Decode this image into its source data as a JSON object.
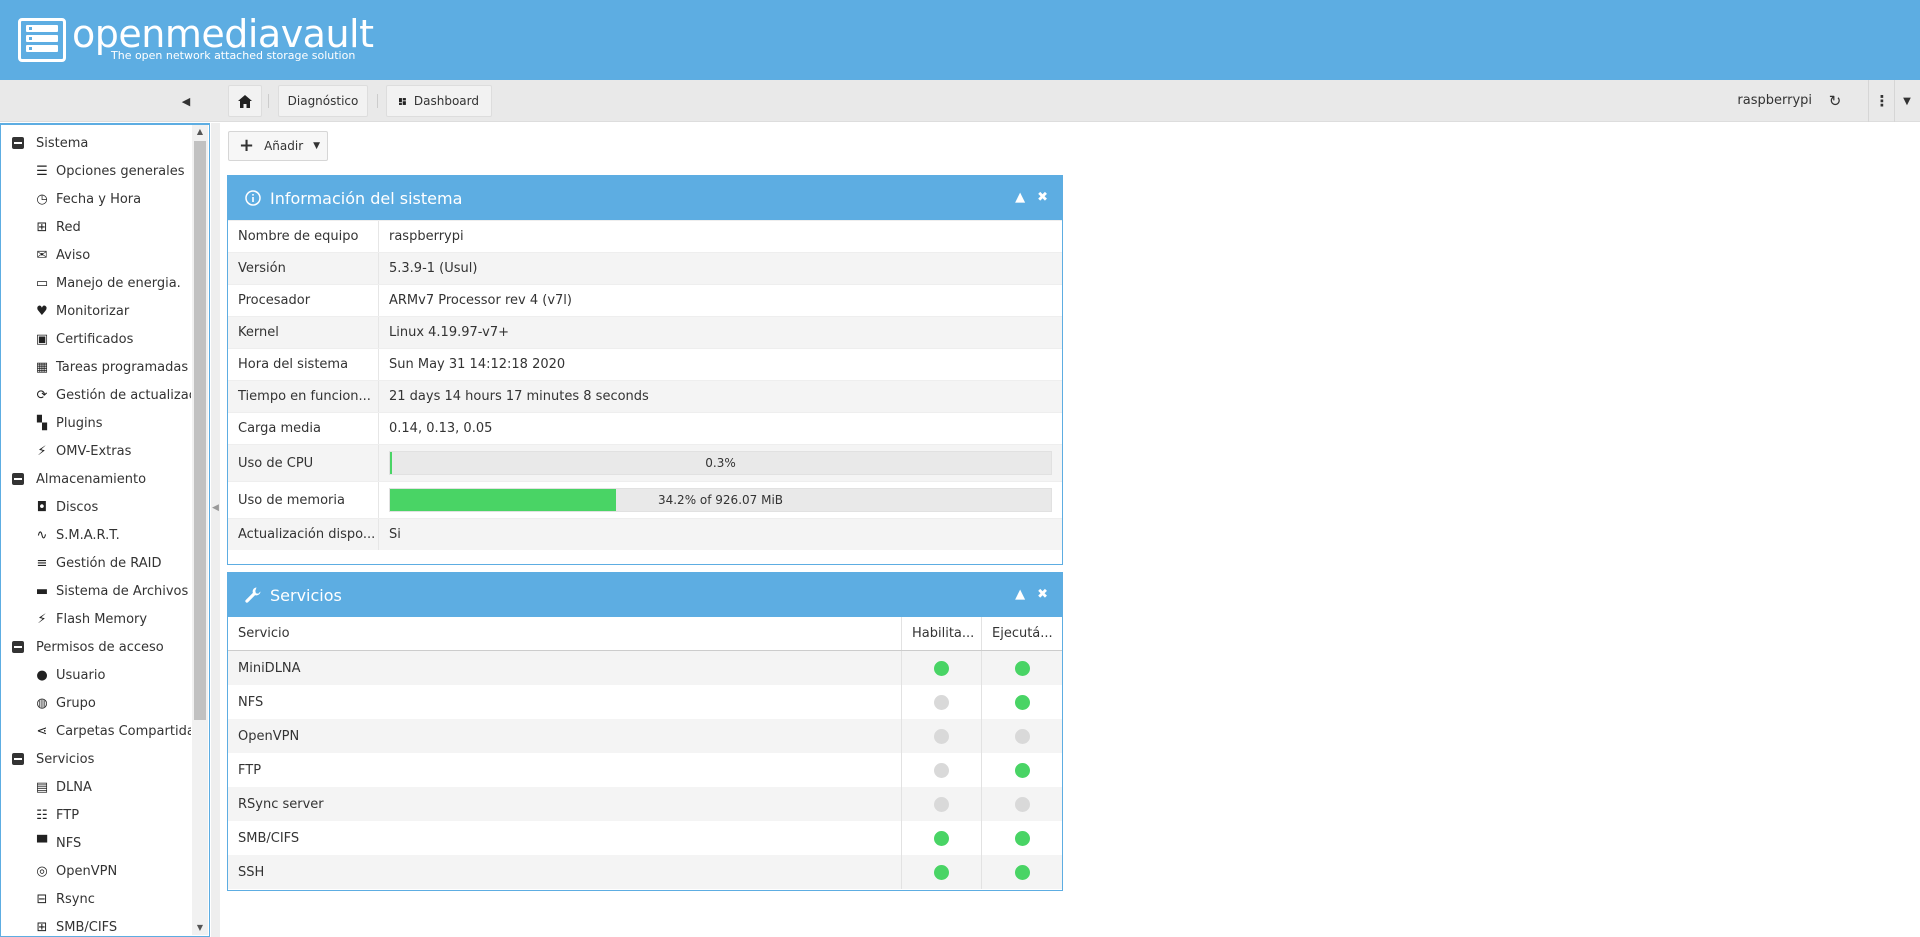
{
  "brand": {
    "title": "openmediavault",
    "subtitle": "The open network attached storage solution"
  },
  "toolbar": {
    "home_icon": "home-icon",
    "crumbs": [
      "Diagnóstico",
      "Dashboard"
    ],
    "hostname": "raspberrypi"
  },
  "sidebar": {
    "groups": [
      {
        "label": "Sistema",
        "items": [
          {
            "label": "Opciones generales",
            "icon": "sliders-icon"
          },
          {
            "label": "Fecha y Hora",
            "icon": "clock-icon"
          },
          {
            "label": "Red",
            "icon": "network-icon"
          },
          {
            "label": "Aviso",
            "icon": "envelope-icon"
          },
          {
            "label": "Manejo de energia.",
            "icon": "battery-icon"
          },
          {
            "label": "Monitorizar",
            "icon": "heartbeat-icon"
          },
          {
            "label": "Certificados",
            "icon": "certificate-icon"
          },
          {
            "label": "Tareas programadas",
            "icon": "calendar-clock-icon"
          },
          {
            "label": "Gestión de actualizacio",
            "icon": "refresh-icon"
          },
          {
            "label": "Plugins",
            "icon": "puzzle-icon"
          },
          {
            "label": "OMV-Extras",
            "icon": "plug-icon"
          }
        ]
      },
      {
        "label": "Almacenamiento",
        "items": [
          {
            "label": "Discos",
            "icon": "disk-icon"
          },
          {
            "label": "S.M.A.R.T.",
            "icon": "pulse-icon"
          },
          {
            "label": "Gestión de RAID",
            "icon": "database-icon"
          },
          {
            "label": "Sistema de Archivos",
            "icon": "folders-icon"
          },
          {
            "label": "Flash Memory",
            "icon": "bolt-icon"
          }
        ]
      },
      {
        "label": "Permisos de acceso",
        "items": [
          {
            "label": "Usuario",
            "icon": "user-icon"
          },
          {
            "label": "Grupo",
            "icon": "users-icon"
          },
          {
            "label": "Carpetas Compartidas",
            "icon": "share-icon"
          }
        ]
      },
      {
        "label": "Servicios",
        "items": [
          {
            "label": "DLNA",
            "icon": "film-icon"
          },
          {
            "label": "FTP",
            "icon": "server-icon"
          },
          {
            "label": "NFS",
            "icon": "desktop-icon"
          },
          {
            "label": "OpenVPN",
            "icon": "wifi-icon"
          },
          {
            "label": "Rsync",
            "icon": "sync-network-icon"
          },
          {
            "label": "SMB/CIFS",
            "icon": "windows-icon"
          }
        ]
      }
    ]
  },
  "add_button": {
    "label": "Añadir"
  },
  "sysinfo": {
    "title": "Información del sistema",
    "rows": [
      {
        "key": "Nombre de equipo",
        "value": "raspberrypi"
      },
      {
        "key": "Versión",
        "value": "5.3.9-1 (Usul)"
      },
      {
        "key": "Procesador",
        "value": "ARMv7 Processor rev 4 (v7l)"
      },
      {
        "key": "Kernel",
        "value": "Linux 4.19.97-v7+"
      },
      {
        "key": "Hora del sistema",
        "value": "Sun May 31 14:12:18 2020"
      },
      {
        "key": "Tiempo en funcion...",
        "value": "21 days 14 hours 17 minutes 8 seconds"
      },
      {
        "key": "Carga media",
        "value": "0.14, 0.13, 0.05"
      }
    ],
    "cpu": {
      "key": "Uso de CPU",
      "text": "0.3%",
      "percent": 0.3
    },
    "memory": {
      "key": "Uso de memoria",
      "text": "34.2% of 926.07 MiB",
      "percent": 34.2
    },
    "updates": {
      "key": "Actualización dispo...",
      "value": "Si"
    }
  },
  "services": {
    "title": "Servicios",
    "columns": [
      "Servicio",
      "Habilita...",
      "Ejecutá..."
    ],
    "rows": [
      {
        "name": "MiniDLNA",
        "enabled": true,
        "running": true
      },
      {
        "name": "NFS",
        "enabled": false,
        "running": true
      },
      {
        "name": "OpenVPN",
        "enabled": false,
        "running": false
      },
      {
        "name": "FTP",
        "enabled": false,
        "running": true
      },
      {
        "name": "RSync server",
        "enabled": false,
        "running": false
      },
      {
        "name": "SMB/CIFS",
        "enabled": true,
        "running": true
      },
      {
        "name": "SSH",
        "enabled": true,
        "running": true
      }
    ]
  },
  "colors": {
    "accent": "#5dade2",
    "ok": "#49d465",
    "off": "#d9d9d9"
  }
}
